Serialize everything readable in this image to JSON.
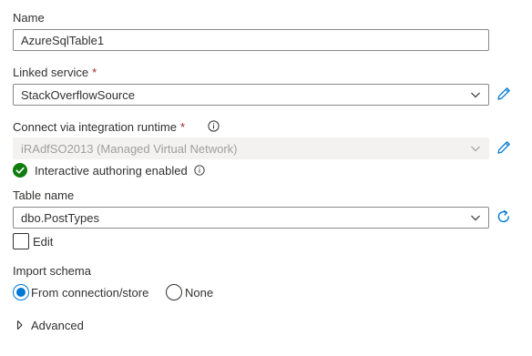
{
  "name": {
    "label": "Name",
    "value": "AzureSqlTable1"
  },
  "linked_service": {
    "label": "Linked service",
    "required_mark": "*",
    "value": "StackOverflowSource"
  },
  "integration_runtime": {
    "label": "Connect via integration runtime",
    "required_mark": "*",
    "value": "iRAdfSO2013 (Managed Virtual Network)",
    "status_text": "Interactive authoring enabled"
  },
  "table_name": {
    "label": "Table name",
    "value": "dbo.PostTypes",
    "edit_label": "Edit",
    "edit_checked": false
  },
  "import_schema": {
    "label": "Import schema",
    "options": [
      {
        "label": "From connection/store",
        "selected": true
      },
      {
        "label": "None",
        "selected": false
      }
    ]
  },
  "advanced": {
    "label": "Advanced"
  },
  "colors": {
    "accent": "#0078d4",
    "success": "#107c10",
    "required": "#a4262c"
  }
}
